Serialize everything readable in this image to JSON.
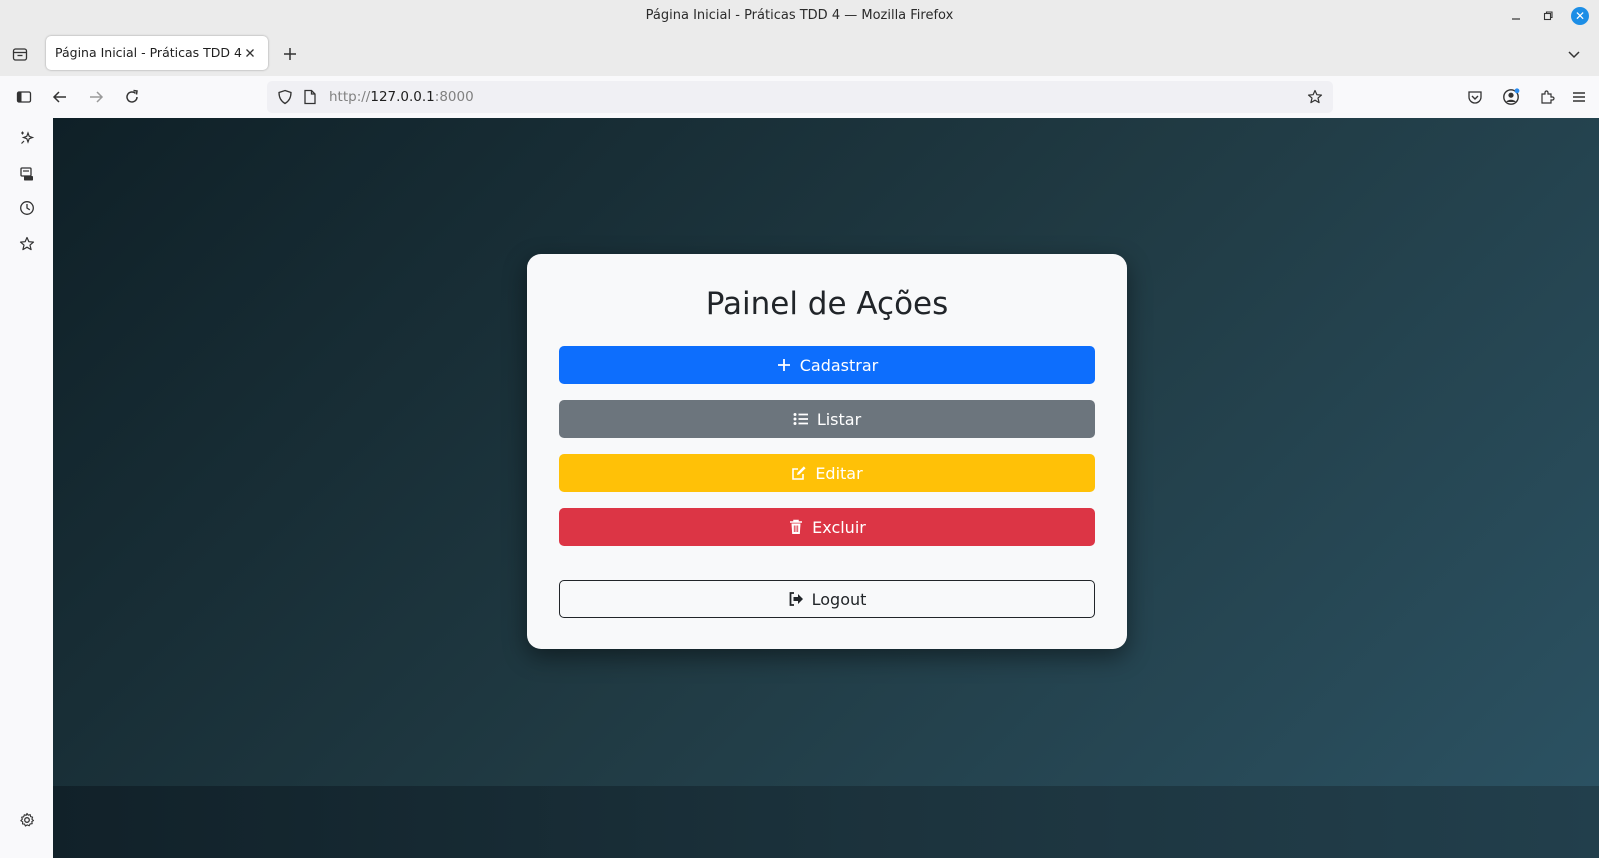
{
  "window": {
    "title": "Página Inicial - Práticas TDD 4 — Mozilla Firefox"
  },
  "tabs": [
    {
      "label": "Página Inicial - Práticas TDD 4",
      "active": true
    }
  ],
  "address_bar": {
    "scheme": "http://",
    "host": "127.0.0.1",
    "port": ":8000"
  },
  "sidebar": {
    "icons": [
      "ai-chatbot-icon",
      "synced-tabs-icon",
      "history-icon",
      "bookmarks-icon",
      "settings-icon"
    ]
  },
  "page": {
    "card_title": "Painel de Ações",
    "buttons": {
      "cadastrar": "Cadastrar",
      "listar": "Listar",
      "editar": "Editar",
      "excluir": "Excluir",
      "logout": "Logout"
    }
  },
  "colors": {
    "primary": "#0d6efd",
    "secondary": "#6c757d",
    "warning": "#ffc107",
    "danger": "#dc3545",
    "dark": "#212529",
    "card_bg": "#f8f9fa",
    "page_gradient": [
      "#0f2027",
      "#203a43",
      "#2c5364"
    ]
  }
}
